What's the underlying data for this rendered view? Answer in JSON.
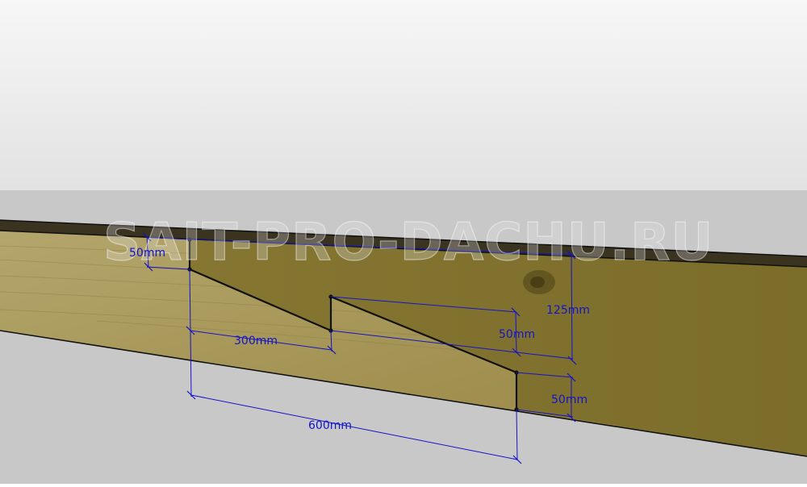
{
  "watermark": "SAIT-PRO-DACHU.RU",
  "dimensions": {
    "top_cut_depth": "50mm",
    "first_step_run": "300mm",
    "second_step_rise": "50mm",
    "overall_depth": "125mm",
    "bottom_cut_depth": "50mm",
    "total_run": "600mm"
  },
  "colors": {
    "sky_top": "#f7f7f7",
    "sky_bottom": "#e2e2e2",
    "ground": "#c8c8c8",
    "dimension": "#1414c8",
    "edge": "#111111",
    "wood_face": "#a89858",
    "wood_cut": "#8a7a36",
    "wood_top": "#3a3320"
  }
}
